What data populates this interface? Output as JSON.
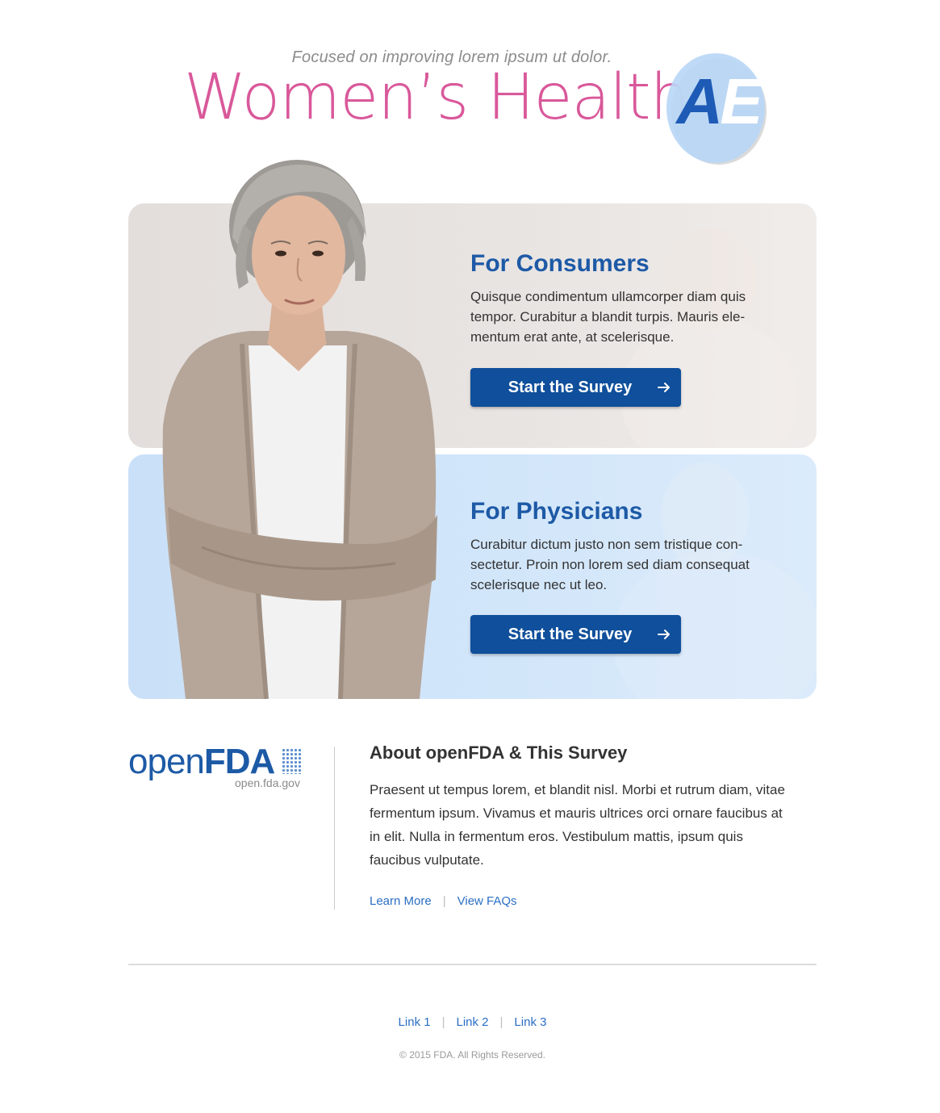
{
  "header": {
    "tagline": "Focused on improving lorem ipsum ut dolor.",
    "title": "Women’s Health",
    "badge_letter_a": "A",
    "badge_letter_e": "E"
  },
  "cards": {
    "consumers": {
      "title": "For Consumers",
      "text": "Quisque condimentum ullamcorper diam quis tempor. Curabitur a blandit turpis. Mauris ele-mentum erat ante, at scelerisque.",
      "button_label": "Start the Survey"
    },
    "physicians": {
      "title": "For Physicians",
      "text": "Curabitur dictum justo non sem tristique con-sectetur. Proin non lorem sed diam consequat scelerisque nec ut leo.",
      "button_label": "Start the Survey"
    }
  },
  "logo": {
    "open": "open",
    "fda": "FDA",
    "domain": "open.fda.gov"
  },
  "about": {
    "title": "About openFDA & This Survey",
    "text": "Praesent ut tempus lorem, et blandit nisl. Morbi et rutrum diam, vitae fermentum ipsum. Vivamus et mauris ultrices orci ornare faucibus at in elit. Nulla in fermentum eros. Vestibulum mattis, ipsum quis faucibus vulputate.",
    "links": {
      "learn_more": "Learn More",
      "view_faqs": "View FAQs"
    }
  },
  "footer": {
    "links": [
      "Link 1",
      "Link 2",
      "Link 3"
    ],
    "separator": "|",
    "copyright": "© 2015 FDA. All Rights Reserved."
  },
  "colors": {
    "brand_pink": "#d9589a",
    "brand_blue": "#1d5aa6",
    "button_blue": "#0f4f9b",
    "link_blue": "#2b6fc4"
  },
  "icons": {
    "button_arrow": "arrow-right-icon",
    "logo_dots": "dot-grid-icon"
  }
}
